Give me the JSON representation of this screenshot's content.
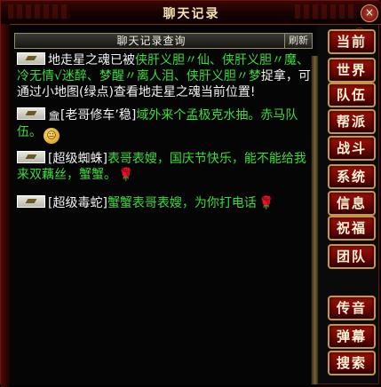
{
  "window": {
    "title": "聊天记录",
    "close_label": "×"
  },
  "header": {
    "title": "聊天记录查询",
    "refresh_label": "刷新"
  },
  "messages": [
    {
      "parts": [
        {
          "t": "地走星之魂已被",
          "c": "w"
        },
        {
          "t": "侠肝义胆",
          "c": "g"
        },
        {
          "t": "〃仙、",
          "c": "g"
        },
        {
          "t": "侠肝义胆",
          "c": "g"
        },
        {
          "t": "〃",
          "c": "g"
        },
        {
          "t": "魔、冷无情",
          "c": "g"
        },
        {
          "t": "√迷醉、梦醒",
          "c": "g"
        },
        {
          "t": "〃离人泪、侠肝义胆",
          "c": "g"
        },
        {
          "t": "〃梦",
          "c": "g"
        },
        {
          "t": "捉拿，可通过小地图(绿点)查看地走星之魂当前位置!",
          "c": "w"
        }
      ]
    },
    {
      "parts": [
        {
          "t": "[老哥修车’稳]",
          "c": "w"
        },
        {
          "t": "域外来个孟极克水抽。赤马队伍。",
          "c": "g"
        }
      ],
      "icon": "pub",
      "emoji": "😐"
    },
    {
      "parts": [
        {
          "t": "[超级蜘蛛]",
          "c": "w"
        },
        {
          "t": "表哥表嫂，国庆节快乐，能不能给我来双藕丝，蟹蟹。",
          "c": "g"
        }
      ],
      "rose": true
    },
    {
      "parts": [
        {
          "t": "[超级毒蛇]",
          "c": "w"
        },
        {
          "t": "蟹蟹表哥表嫂，为你打电话",
          "c": "g"
        }
      ],
      "rose": true
    }
  ],
  "sidebar": {
    "buttons": [
      "当前",
      "世界",
      "队伍",
      "帮派",
      "战斗",
      "系统",
      "信息",
      "祝福",
      "团队",
      "传音",
      "弹幕",
      "搜索"
    ]
  }
}
